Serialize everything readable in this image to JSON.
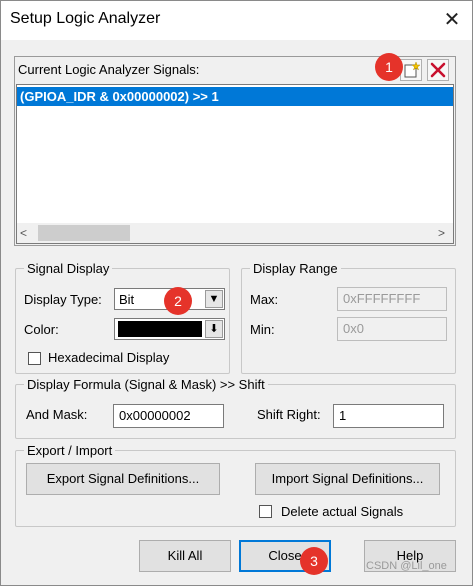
{
  "window": {
    "title": "Setup Logic Analyzer",
    "close_glyph": "✕"
  },
  "signals": {
    "label": "Current Logic Analyzer Signals:",
    "new_icon": "new-signal-icon",
    "delete_icon": "delete-signal-icon",
    "items": [
      "(GPIOA_IDR & 0x00000002) >> 1"
    ],
    "scroll_left": "<",
    "scroll_right": ">"
  },
  "signal_display": {
    "legend": "Signal Display",
    "display_type_label": "Display Type:",
    "display_type_value": "Bit",
    "color_label": "Color:",
    "color_value": "#000000",
    "hex_label": "Hexadecimal Display",
    "hex_checked": false
  },
  "display_range": {
    "legend": "Display Range",
    "max_label": "Max:",
    "max_value": "0xFFFFFFFF",
    "min_label": "Min:",
    "min_value": "0x0"
  },
  "formula": {
    "legend": "Display Formula (Signal & Mask) >> Shift",
    "and_mask_label": "And Mask:",
    "and_mask_value": "0x00000002",
    "shift_label": "Shift Right:",
    "shift_value": "1"
  },
  "export_import": {
    "legend": "Export / Import",
    "export_label": "Export Signal Definitions...",
    "import_label": "Import Signal Definitions...",
    "delete_label": "Delete actual Signals",
    "delete_checked": false
  },
  "buttons": {
    "kill_all": "Kill All",
    "close": "Close",
    "help": "Help"
  },
  "markers": [
    "1",
    "2",
    "3"
  ],
  "watermark": "CSDN @Lil_one",
  "colors": {
    "accent": "#0078d7",
    "marker": "#e5332a"
  }
}
